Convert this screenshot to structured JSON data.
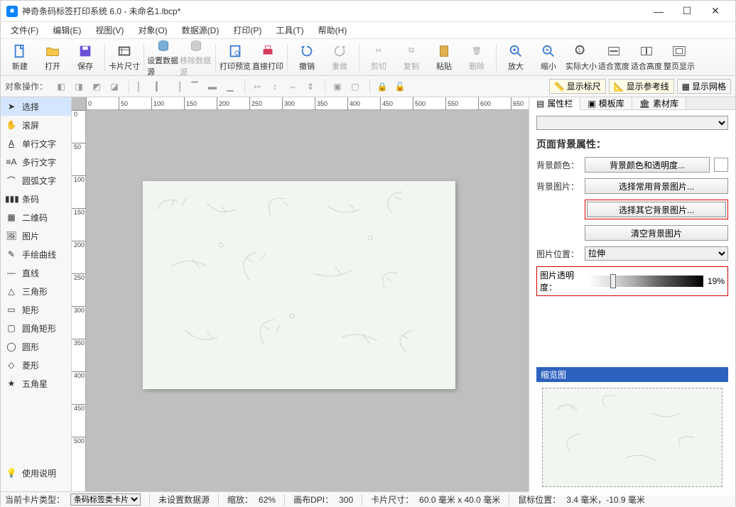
{
  "titlebar": {
    "app_icon": "●",
    "title": "神奇条码标签打印系统 6.0 - 未命名1.lbcp*"
  },
  "menus": [
    "文件(F)",
    "编辑(E)",
    "视图(V)",
    "对象(O)",
    "数据源(D)",
    "打印(P)",
    "工具(T)",
    "帮助(H)"
  ],
  "toolbar": {
    "new": "新建",
    "open": "打开",
    "save": "保存",
    "cardsize": "卡片尺寸",
    "set_ds": "设置数据源",
    "remove_ds": "移除数据源",
    "preview": "打印预览",
    "print": "直接打印",
    "undo": "撤销",
    "redo": "重做",
    "cut": "剪切",
    "copy": "复制",
    "paste": "粘贴",
    "delete": "删除",
    "zoomin": "放大",
    "zoomout": "缩小",
    "actual": "实际大小",
    "fitw": "适合宽度",
    "fith": "适合高度",
    "fitpage": "整页显示"
  },
  "toolbar2": {
    "label": "对象操作：",
    "show_ruler": "显示标尺",
    "show_guide": "显示参考线",
    "show_grid": "显示网格"
  },
  "left_tools": {
    "select": "选择",
    "pan": "滚屏",
    "text": "单行文字",
    "mtext": "多行文字",
    "arctext": "圆弧文字",
    "barcode": "条码",
    "qrcode": "二维码",
    "image": "图片",
    "freehand": "手绘曲线",
    "line": "直线",
    "triangle": "三角形",
    "rect": "矩形",
    "roundrect": "圆角矩形",
    "circle": "圆形",
    "diamond": "菱形",
    "star": "五角星",
    "help": "使用说明"
  },
  "ruler_h": [
    "0",
    "50",
    "100",
    "150",
    "200",
    "250",
    "300",
    "350",
    "400",
    "450",
    "500",
    "550",
    "600",
    "650"
  ],
  "ruler_v": [
    "0",
    "50",
    "100",
    "150",
    "200",
    "250",
    "300",
    "350",
    "400",
    "450",
    "500"
  ],
  "rp_tabs": {
    "props": "属性栏",
    "tpl": "模板库",
    "assets": "素材库"
  },
  "props": {
    "title": "页面背景属性：",
    "bg_color_lbl": "背景颜色：",
    "bg_color_btn": "背景颜色和透明度...",
    "bg_img_lbl": "背景图片：",
    "choose_common": "选择常用背景图片...",
    "choose_other": "选择其它背景图片...",
    "clear_bg": "清空背景图片",
    "pos_lbl": "图片位置：",
    "pos_val": "拉伸",
    "opacity_lbl": "图片透明度：",
    "opacity_pct": "19%",
    "opacity_ratio": 0.19
  },
  "preview": {
    "title": "缩览图"
  },
  "status": {
    "type_lbl": "当前卡片类型：",
    "type_val": "条码标签类卡片",
    "ds": "未设置数据源",
    "zoom_lbl": "缩放：",
    "zoom_val": "62%",
    "dpi_lbl": "画布DPI：",
    "dpi_val": "300",
    "size_lbl": "卡片尺寸：",
    "size_val": "60.0 毫米 x 40.0 毫米",
    "mouse_lbl": "鼠标位置：",
    "mouse_val": "3.4 毫米，-10.9 毫米"
  }
}
